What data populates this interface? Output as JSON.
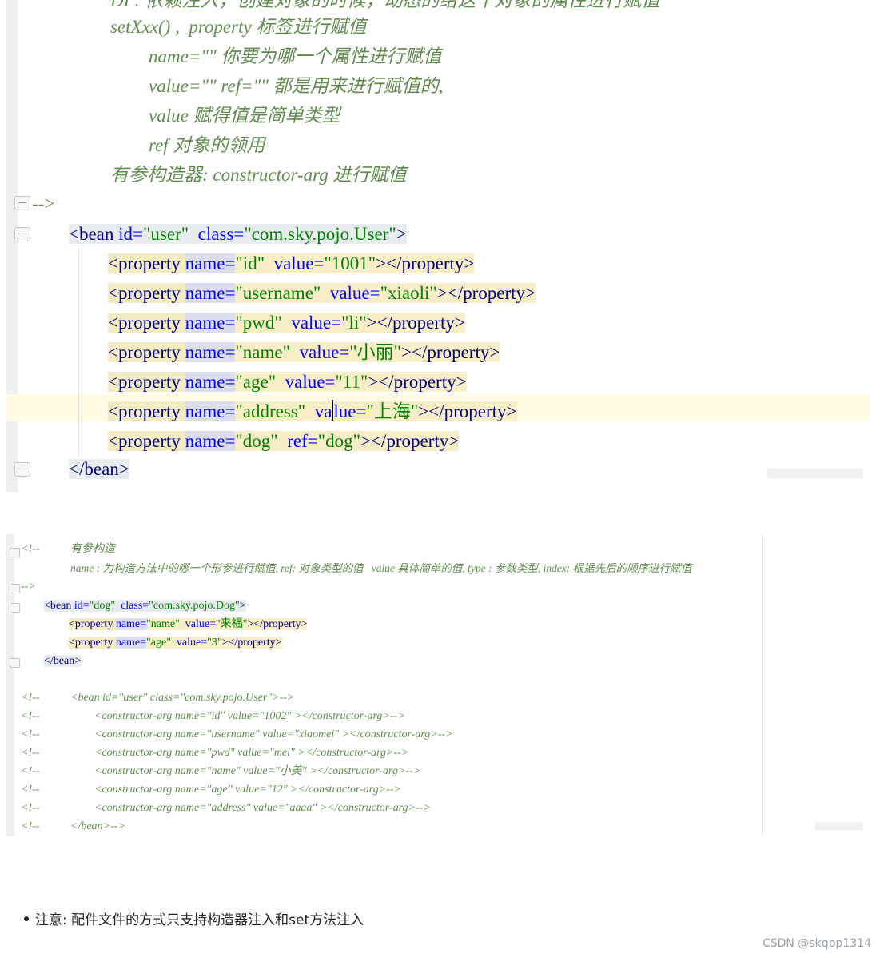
{
  "top_code": {
    "comment_lines": [
      "DI : 依赖注入，创建对象的时候，动态的给这个对象的属性进行赋值",
      "setXxx() ,  property 标签进行赋值",
      "name=\"\" 你要为哪一个属性进行赋值",
      "value=\"\" ref=\"\" 都是用来进行赋值的,",
      "value 赋得值是简单类型",
      "ref 对象的领用",
      "有参构造器: constructor-arg 进行赋值"
    ],
    "comment_close": "-->",
    "bean_open": {
      "tag": "<bean",
      "id_attr": "id=",
      "id_val": "\"user\"",
      "class_attr": "class=",
      "class_val": "\"com.sky.pojo.User\"",
      "close": ">"
    },
    "properties": [
      {
        "attr1": "name=",
        "val1": "\"id\"",
        "attr2": "value=",
        "val2": "\"1001\""
      },
      {
        "attr1": "name=",
        "val1": "\"username\"",
        "attr2": "value=",
        "val2": "\"xiaoli\""
      },
      {
        "attr1": "name=",
        "val1": "\"pwd\"",
        "attr2": "value=",
        "val2": "\"li\""
      },
      {
        "attr1": "name=",
        "val1": "\"name\"",
        "attr2": "value=",
        "val2": "\"小丽\""
      },
      {
        "attr1": "name=",
        "val1": "\"age\"",
        "attr2": "value=",
        "val2": "\"11\""
      },
      {
        "attr1": "name=",
        "val1": "\"address\"",
        "attr2a": "va",
        "attr2b": "lue=",
        "val2": "\"上海\""
      },
      {
        "attr1": "name=",
        "val1": "\"dog\"",
        "attr2": "ref=",
        "val2": "\"dog\""
      }
    ],
    "prop_open": "<property",
    "prop_close": "></property>",
    "bean_close": "</bean>"
  },
  "bottom_code": {
    "comment_open": "<!--",
    "comment_title": "有参构造",
    "comment_desc": "name : 为构造方法中的哪一个形参进行赋值, ref: 对象类型的值   value 具体简单的值, type : 参数类型, index: 根据先后的顺序进行赋值",
    "comment_close": "-->",
    "bean_open": {
      "tag": "<bean",
      "id_attr": "id=",
      "id_val": "\"dog\"",
      "class_attr": "class=",
      "class_val": "\"com.sky.pojo.Dog\"",
      "close": ">"
    },
    "properties": [
      {
        "attr1": "name=",
        "val1": "\"name\"",
        "attr2": "value=",
        "val2": "\"来福\""
      },
      {
        "attr1": "name=",
        "val1": "\"age\"",
        "attr2": "value=",
        "val2": "\"3\""
      }
    ],
    "prop_open": "<property",
    "prop_close": "></property>",
    "bean_close": "</bean>",
    "commented_lines": [
      {
        "prefix": "<!--",
        "text": "<bean id=\"user\" class=\"com.sky.pojo.User\">-->"
      },
      {
        "prefix": "<!--",
        "text": "<constructor-arg name=\"id\" value=\"1002\" ></constructor-arg>-->"
      },
      {
        "prefix": "<!--",
        "text": "<constructor-arg name=\"username\" value=\"xiaomei\" ></constructor-arg>-->"
      },
      {
        "prefix": "<!--",
        "text": "<constructor-arg name=\"pwd\" value=\"mei\" ></constructor-arg>-->"
      },
      {
        "prefix": "<!--",
        "text": "<constructor-arg name=\"name\" value=\"小美\" ></constructor-arg>-->"
      },
      {
        "prefix": "<!--",
        "text": "<constructor-arg name=\"age\" value=\"12\" ></constructor-arg>-->"
      },
      {
        "prefix": "<!--",
        "text": "<constructor-arg name=\"address\" value=\"aaaa\" ></constructor-arg>-->"
      },
      {
        "prefix": "<!--",
        "text": "</bean>-->"
      }
    ]
  },
  "note": "注意: 配件文件的方式只支持构造器注入和set方法注入",
  "watermark": "CSDN @skqpp1314"
}
